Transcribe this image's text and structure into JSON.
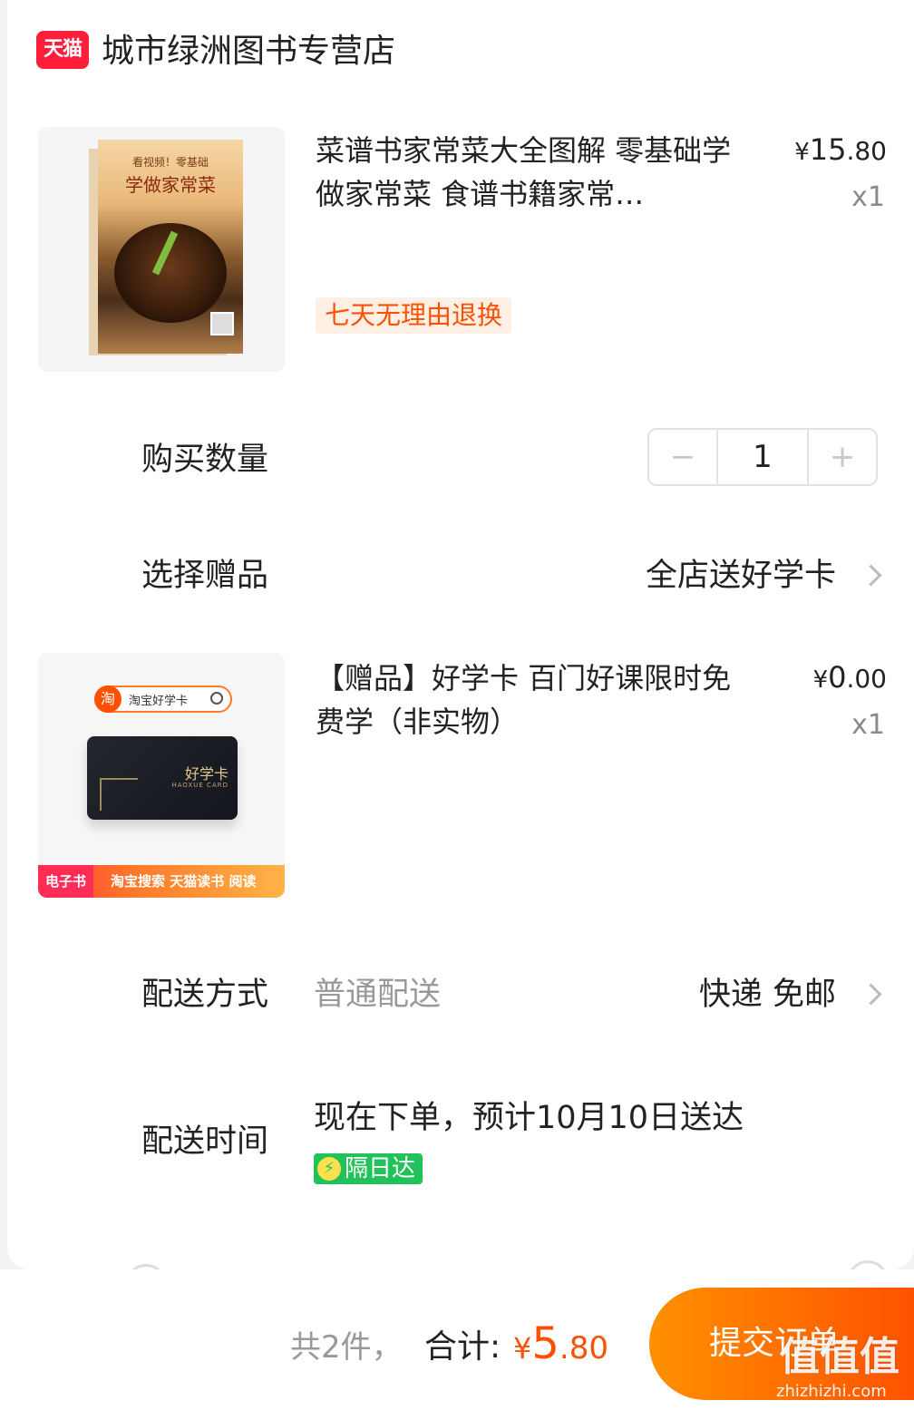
{
  "shop": {
    "badge": "天猫",
    "name": "城市绿洲图书专营店"
  },
  "items": [
    {
      "title": "菜谱书家常菜大全图解 零基础学做家常菜 食谱书籍家常…",
      "price_currency": "¥",
      "price_int": "15",
      "price_dec": ".80",
      "quantity": "x1",
      "tag": "七天无理由退换",
      "cover_line1": "看视频！零基础",
      "cover_line2": "学做家常菜"
    },
    {
      "title": "【赠品】好学卡 百门好课限时免费学（非实物）",
      "price_currency": "¥",
      "price_int": "0",
      "price_dec": ".00",
      "quantity": "x1",
      "search_icon": "淘",
      "search_text": "淘宝好学卡",
      "card_name": "好学卡",
      "card_sub": "HAOXUE CARD",
      "banner_tag": "电子书",
      "banner_text": "淘宝搜索 天猫读书 阅读"
    }
  ],
  "purchase_qty": {
    "label": "购买数量",
    "value": "1",
    "minus": "−",
    "plus": "+"
  },
  "gift": {
    "label": "选择赠品",
    "value": "全店送好学卡"
  },
  "delivery_method": {
    "label": "配送方式",
    "type": "普通配送",
    "value": "快递 免邮"
  },
  "delivery_time": {
    "label": "配送时间",
    "value": "现在下单，预计10月10日送达",
    "tag": "隔日达",
    "tag_icon": "⚡"
  },
  "footer": {
    "count": "共2件，",
    "total_label": "合计:",
    "total_currency": "¥",
    "total_int": "5",
    "total_dec": ".80",
    "submit": "提交订单"
  },
  "watermark": {
    "text": "值值值",
    "url": "zhizhizhi.com"
  },
  "colors": {
    "accent": "#ff5000",
    "tmall": "#ff1f3a",
    "nextday": "#21c25a"
  }
}
